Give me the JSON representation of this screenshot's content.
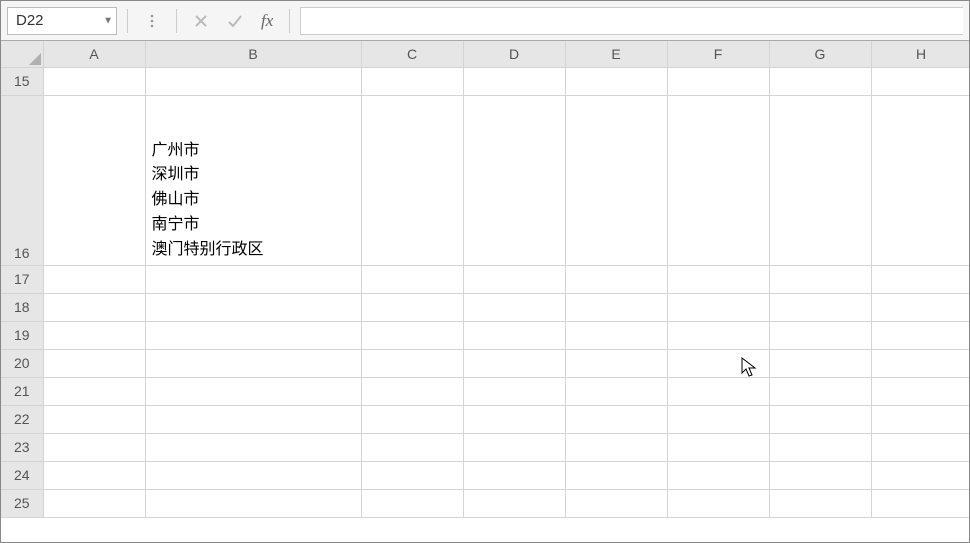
{
  "namebox": {
    "value": "D22"
  },
  "formula": {
    "value": ""
  },
  "icons": {
    "fx": "fx"
  },
  "columns": [
    "A",
    "B",
    "C",
    "D",
    "E",
    "F",
    "G",
    "H"
  ],
  "rows": [
    15,
    16,
    17,
    18,
    19,
    20,
    21,
    22,
    23,
    24,
    25
  ],
  "cells": {
    "B16": "广州市\n深圳市\n佛山市\n南宁市\n澳门特别行政区"
  }
}
